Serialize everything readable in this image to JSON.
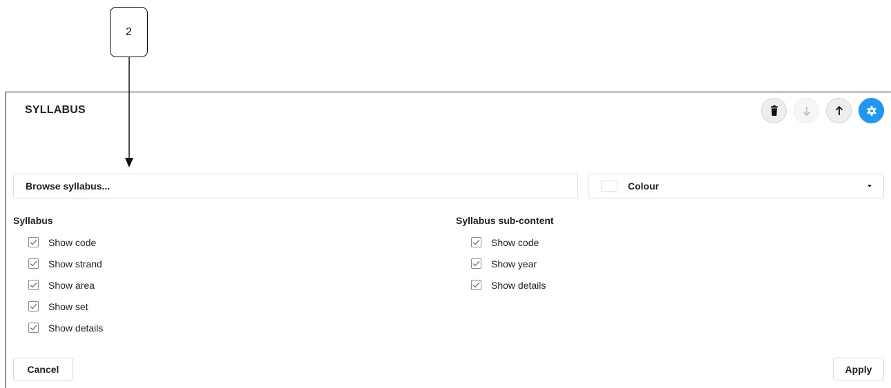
{
  "annotation": {
    "number": "2"
  },
  "panel": {
    "title": "SYLLABUS",
    "actions": [
      {
        "name": "delete",
        "icon": "trash-icon",
        "disabled": false
      },
      {
        "name": "move-down",
        "icon": "arrow-down-icon",
        "disabled": true
      },
      {
        "name": "move-up",
        "icon": "arrow-up-icon",
        "disabled": false
      },
      {
        "name": "settings",
        "icon": "gear-icon",
        "disabled": false,
        "color": "#2196f3"
      }
    ]
  },
  "browse": {
    "label": "Browse syllabus..."
  },
  "colour": {
    "label": "Colour",
    "value": "#ffffff"
  },
  "syllabus": {
    "title": "Syllabus",
    "options": [
      {
        "label": "Show code",
        "checked": true
      },
      {
        "label": "Show strand",
        "checked": true
      },
      {
        "label": "Show area",
        "checked": true
      },
      {
        "label": "Show set",
        "checked": true
      },
      {
        "label": "Show details",
        "checked": true
      }
    ]
  },
  "subcontent": {
    "title": "Syllabus sub-content",
    "options": [
      {
        "label": "Show code",
        "checked": true
      },
      {
        "label": "Show year",
        "checked": true
      },
      {
        "label": "Show details",
        "checked": true
      }
    ]
  },
  "footer": {
    "cancel_label": "Cancel",
    "apply_label": "Apply"
  }
}
